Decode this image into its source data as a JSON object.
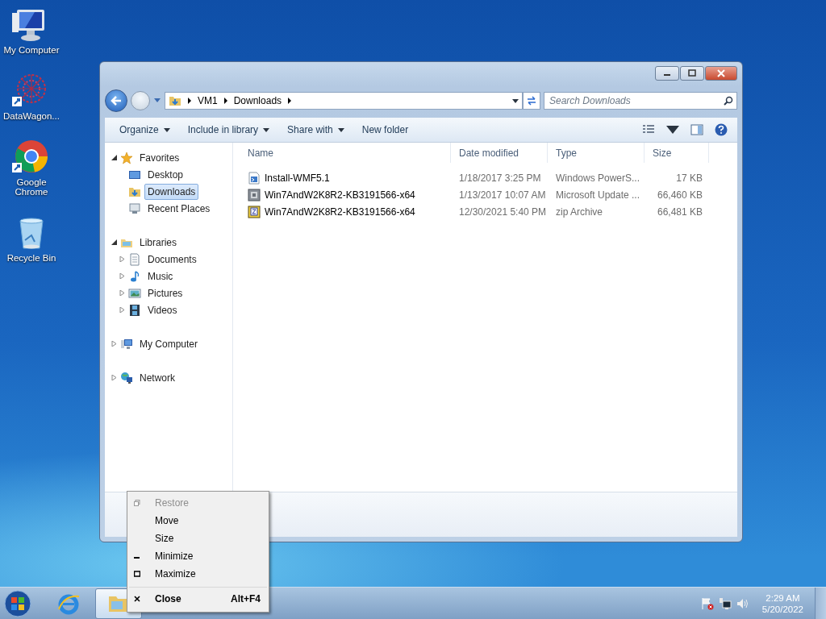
{
  "desktop_icons": [
    {
      "kind": "computer",
      "label": "My Computer"
    },
    {
      "kind": "shortcut-web",
      "label": "DataWagon..."
    },
    {
      "kind": "shortcut-chrome",
      "label": "Google Chrome"
    },
    {
      "kind": "recycle",
      "label": "Recycle Bin"
    }
  ],
  "window": {
    "address": [
      "VM1",
      "Downloads"
    ],
    "search": {
      "placeholder": "Search Downloads"
    },
    "toolbar": [
      "Organize",
      "Include in library",
      "Share with",
      "New folder"
    ],
    "nav": [
      {
        "label": "Favorites",
        "expanded": true,
        "children": [
          {
            "label": "Desktop",
            "selected": false
          },
          {
            "label": "Downloads",
            "selected": true
          },
          {
            "label": "Recent Places",
            "selected": false
          }
        ]
      },
      {
        "label": "Libraries",
        "expanded": true,
        "children": [
          {
            "label": "Documents",
            "expanded": false
          },
          {
            "label": "Music",
            "expanded": false
          },
          {
            "label": "Pictures",
            "expanded": false
          },
          {
            "label": "Videos",
            "expanded": false
          }
        ]
      },
      {
        "label": "My Computer",
        "expanded": false
      },
      {
        "label": "Network",
        "expanded": false
      }
    ],
    "columns": [
      "Name",
      "Date modified",
      "Type",
      "Size"
    ],
    "files": [
      {
        "kind": "script",
        "name": "Install-WMF5.1",
        "date": "1/18/2017 3:25 PM",
        "type": "Windows PowerS...",
        "size": "17 KB"
      },
      {
        "kind": "update",
        "name": "Win7AndW2K8R2-KB3191566-x64",
        "date": "1/13/2017 10:07 AM",
        "type": "Microsoft Update ...",
        "size": "66,460 KB"
      },
      {
        "kind": "zip",
        "name": "Win7AndW2K8R2-KB3191566-x64",
        "date": "12/30/2021 5:40 PM",
        "type": "zip Archive",
        "size": "66,481 KB"
      }
    ]
  },
  "context_menu": [
    {
      "kind": "restore",
      "label": "Restore",
      "disabled": true
    },
    {
      "kind": "none",
      "label": "Move",
      "disabled": false
    },
    {
      "kind": "none",
      "label": "Size",
      "disabled": false
    },
    {
      "kind": "minimize",
      "label": "Minimize",
      "disabled": false
    },
    {
      "kind": "maximize",
      "label": "Maximize",
      "disabled": false
    },
    {
      "kind": "close",
      "label": "Close",
      "shortcut": "Alt+F4",
      "disabled": false
    }
  ],
  "taskbar": {
    "buttons": [
      {
        "kind": "ie",
        "active": false
      },
      {
        "kind": "explorer",
        "active": true
      }
    ],
    "clock": {
      "time": "2:29 AM",
      "date": "5/20/2022"
    }
  }
}
